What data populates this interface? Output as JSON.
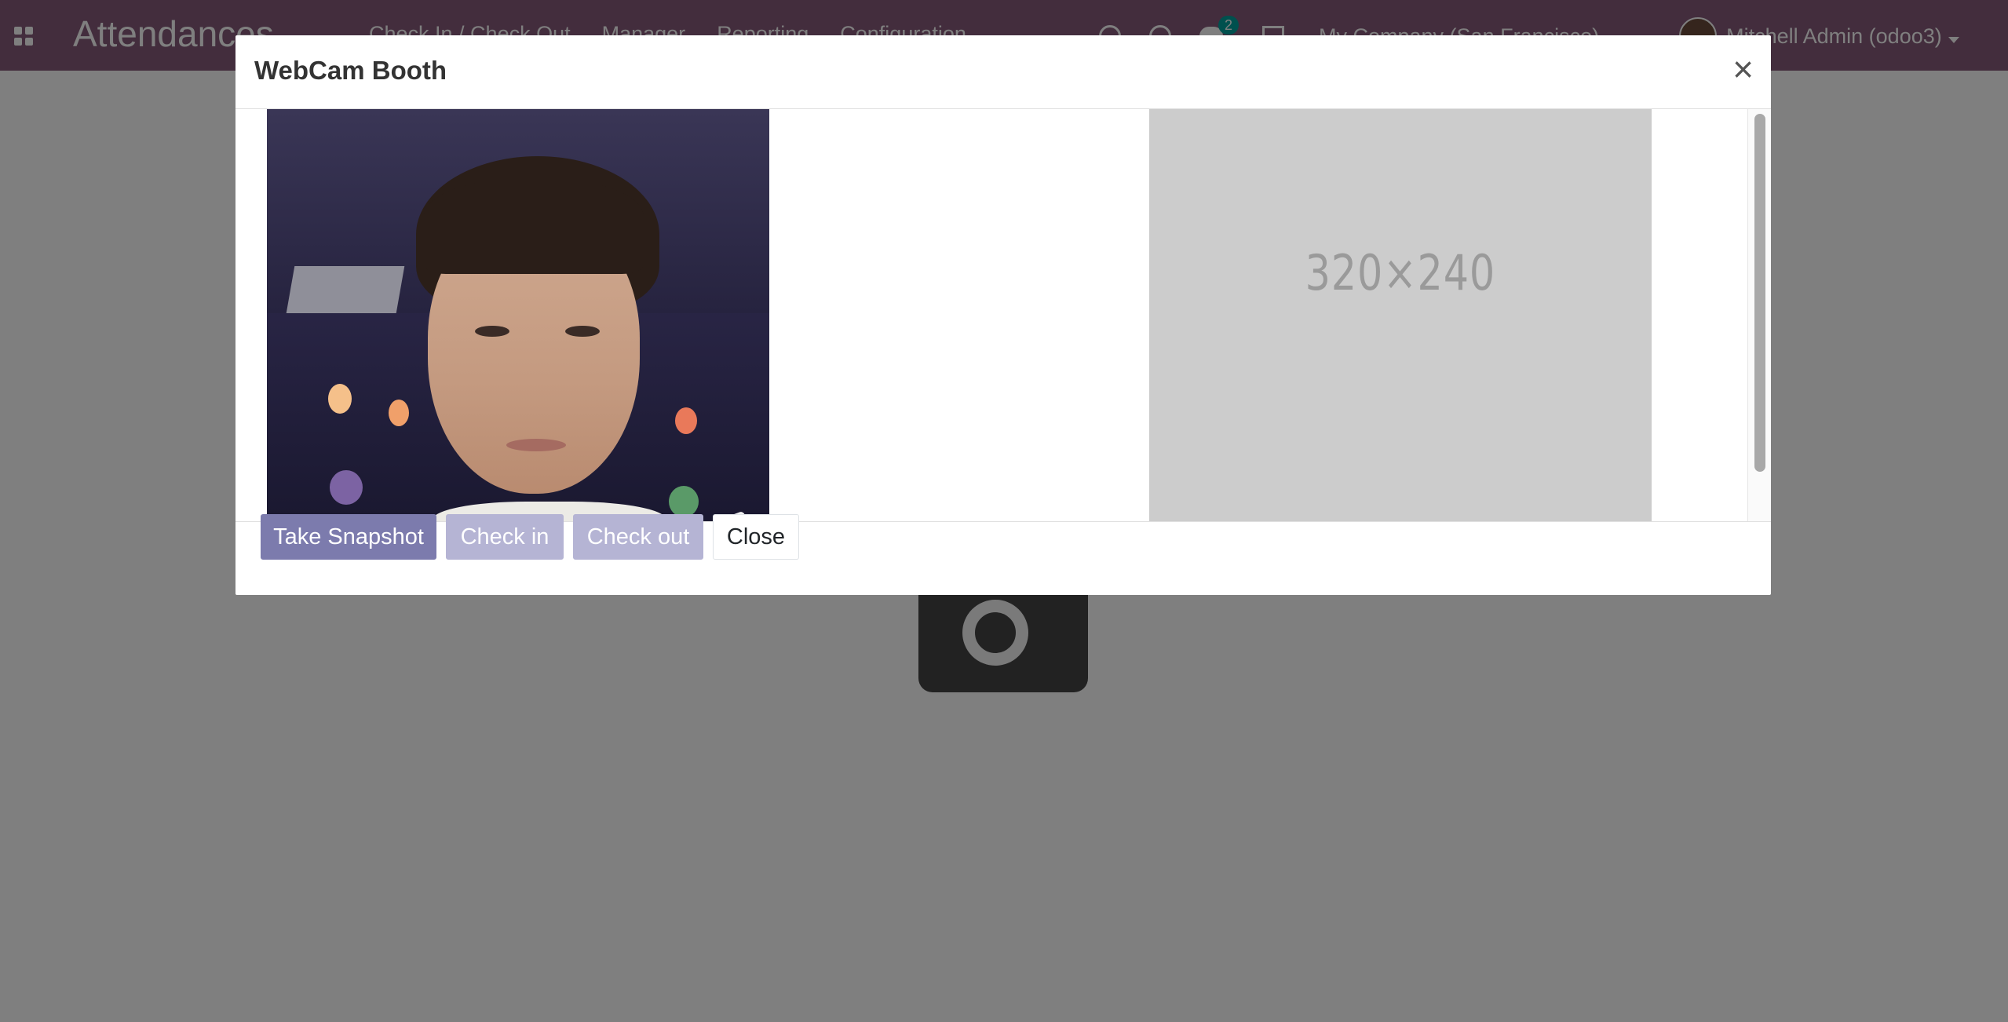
{
  "app": {
    "title": "Attendances",
    "menu": [
      "Check In / Check Out",
      "Manager",
      "Reporting",
      "Configuration"
    ],
    "chat_badge": "2",
    "company": "My Company (San Francisco)",
    "user": "Mitchell Admin (odoo3)",
    "navbar_color": "#875a7b"
  },
  "modal": {
    "title": "WebCam Booth",
    "close_symbol": "×",
    "placeholder_text": "320×240",
    "buttons": {
      "take_snapshot": "Take Snapshot",
      "check_in": "Check in",
      "check_out": "Check out",
      "close": "Close"
    },
    "button_colors": {
      "primary": "#7c7bad",
      "primary_disabled": "#b5b4d4"
    },
    "icons": {
      "arrow": "chevron-right-icon",
      "close": "close-icon",
      "camera": "camera-icon"
    }
  }
}
